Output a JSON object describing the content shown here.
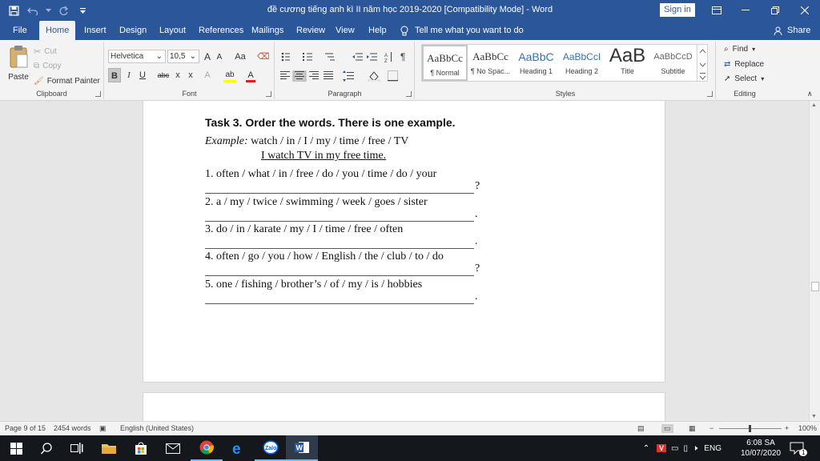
{
  "window": {
    "title": "đề cương tiếng anh kì II năm học 2019-2020 [Compatibility Mode]  -  Word",
    "sign_in": "Sign in"
  },
  "tabs": [
    "File",
    "Home",
    "Insert",
    "Design",
    "Layout",
    "References",
    "Mailings",
    "Review",
    "View",
    "Help"
  ],
  "tell_me": "Tell me what you want to do",
  "share": "Share",
  "clipboard": {
    "paste": "Paste",
    "cut": "Cut",
    "copy": "Copy",
    "format_painter": "Format Painter",
    "label": "Clipboard"
  },
  "font": {
    "family": "Helvetica",
    "size": "10,5",
    "label": "Font",
    "grow": "A",
    "shrink": "A",
    "change_case": "Aa",
    "bold": "B",
    "italic": "I",
    "underline": "U",
    "strike": "abc",
    "sub": "x",
    "sup": "x",
    "effects": "A",
    "highlight": "ab",
    "color": "A"
  },
  "paragraph": {
    "label": "Paragraph"
  },
  "styles": {
    "label": "Styles",
    "items": [
      {
        "sample": "AaBbCc",
        "name": "¶ Normal"
      },
      {
        "sample": "AaBbCc",
        "name": "¶ No Spac..."
      },
      {
        "sample": "AaBbC",
        "name": "Heading 1"
      },
      {
        "sample": "AaBbCcI",
        "name": "Heading 2"
      },
      {
        "sample": "AaB",
        "name": "Title"
      },
      {
        "sample": "AaBbCcD",
        "name": "Subtitle"
      }
    ]
  },
  "editing": {
    "label": "Editing",
    "find": "Find",
    "replace": "Replace",
    "select": "Select"
  },
  "document": {
    "heading": "Task 3. Order the words. There is one example.",
    "example_label": "Example:",
    "example_words": " watch / in / I / my / time / free / TV",
    "example_answer": "I watch TV in my free time.",
    "items": [
      {
        "text": "1. often / what / in / free / do / you / time / do / your",
        "end": "?"
      },
      {
        "text": "2. a / my / twice / swimming / week / goes / sister",
        "end": "."
      },
      {
        "text": "3. do / in / karate / my / I / time / free / often",
        "end": "."
      },
      {
        "text": "4. often / go / you / how / English / the / club / to / do",
        "end": "?"
      },
      {
        "text": "5. one / fishing / brother’s / of / my / is / hobbies",
        "end": "."
      }
    ]
  },
  "status": {
    "page": "Page 9 of 15",
    "words": "2454 words",
    "language": "English (United States)",
    "zoom": "100%"
  },
  "taskbar": {
    "lang": "ENG",
    "time": "6:08 SA",
    "date": "10/07/2020",
    "notifications": "1",
    "zalo": "Zalo"
  },
  "colors": {
    "word_blue": "#2b579a",
    "taskbar": "#14171c"
  }
}
